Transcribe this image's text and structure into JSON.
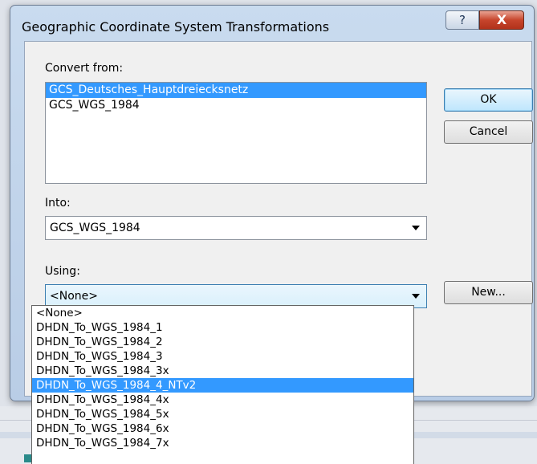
{
  "dialog": {
    "title": "Geographic Coordinate System Transformations",
    "help_glyph": "?",
    "close_glyph": "X"
  },
  "convert_from": {
    "label": "Convert from:",
    "items": [
      {
        "label": "GCS_Deutsches_Hauptdreiecksnetz",
        "selected": true
      },
      {
        "label": "GCS_WGS_1984",
        "selected": false
      }
    ]
  },
  "into": {
    "label": "Into:",
    "value": "GCS_WGS_1984"
  },
  "using": {
    "label": "Using:",
    "value": "<None>",
    "options": [
      {
        "label": "<None>",
        "selected": false
      },
      {
        "label": "DHDN_To_WGS_1984_1",
        "selected": false
      },
      {
        "label": "DHDN_To_WGS_1984_2",
        "selected": false
      },
      {
        "label": "DHDN_To_WGS_1984_3",
        "selected": false
      },
      {
        "label": "DHDN_To_WGS_1984_3x",
        "selected": false
      },
      {
        "label": "DHDN_To_WGS_1984_4_NTv2",
        "selected": true
      },
      {
        "label": "DHDN_To_WGS_1984_4x",
        "selected": false
      },
      {
        "label": "DHDN_To_WGS_1984_5x",
        "selected": false
      },
      {
        "label": "DHDN_To_WGS_1984_6x",
        "selected": false
      },
      {
        "label": "DHDN_To_WGS_1984_7x",
        "selected": false
      }
    ]
  },
  "buttons": {
    "ok": "OK",
    "cancel": "Cancel",
    "new": "New..."
  },
  "colors": {
    "selection": "#3399ff",
    "default_button_border": "#3c7fb1",
    "close_button": "#c7452c"
  }
}
